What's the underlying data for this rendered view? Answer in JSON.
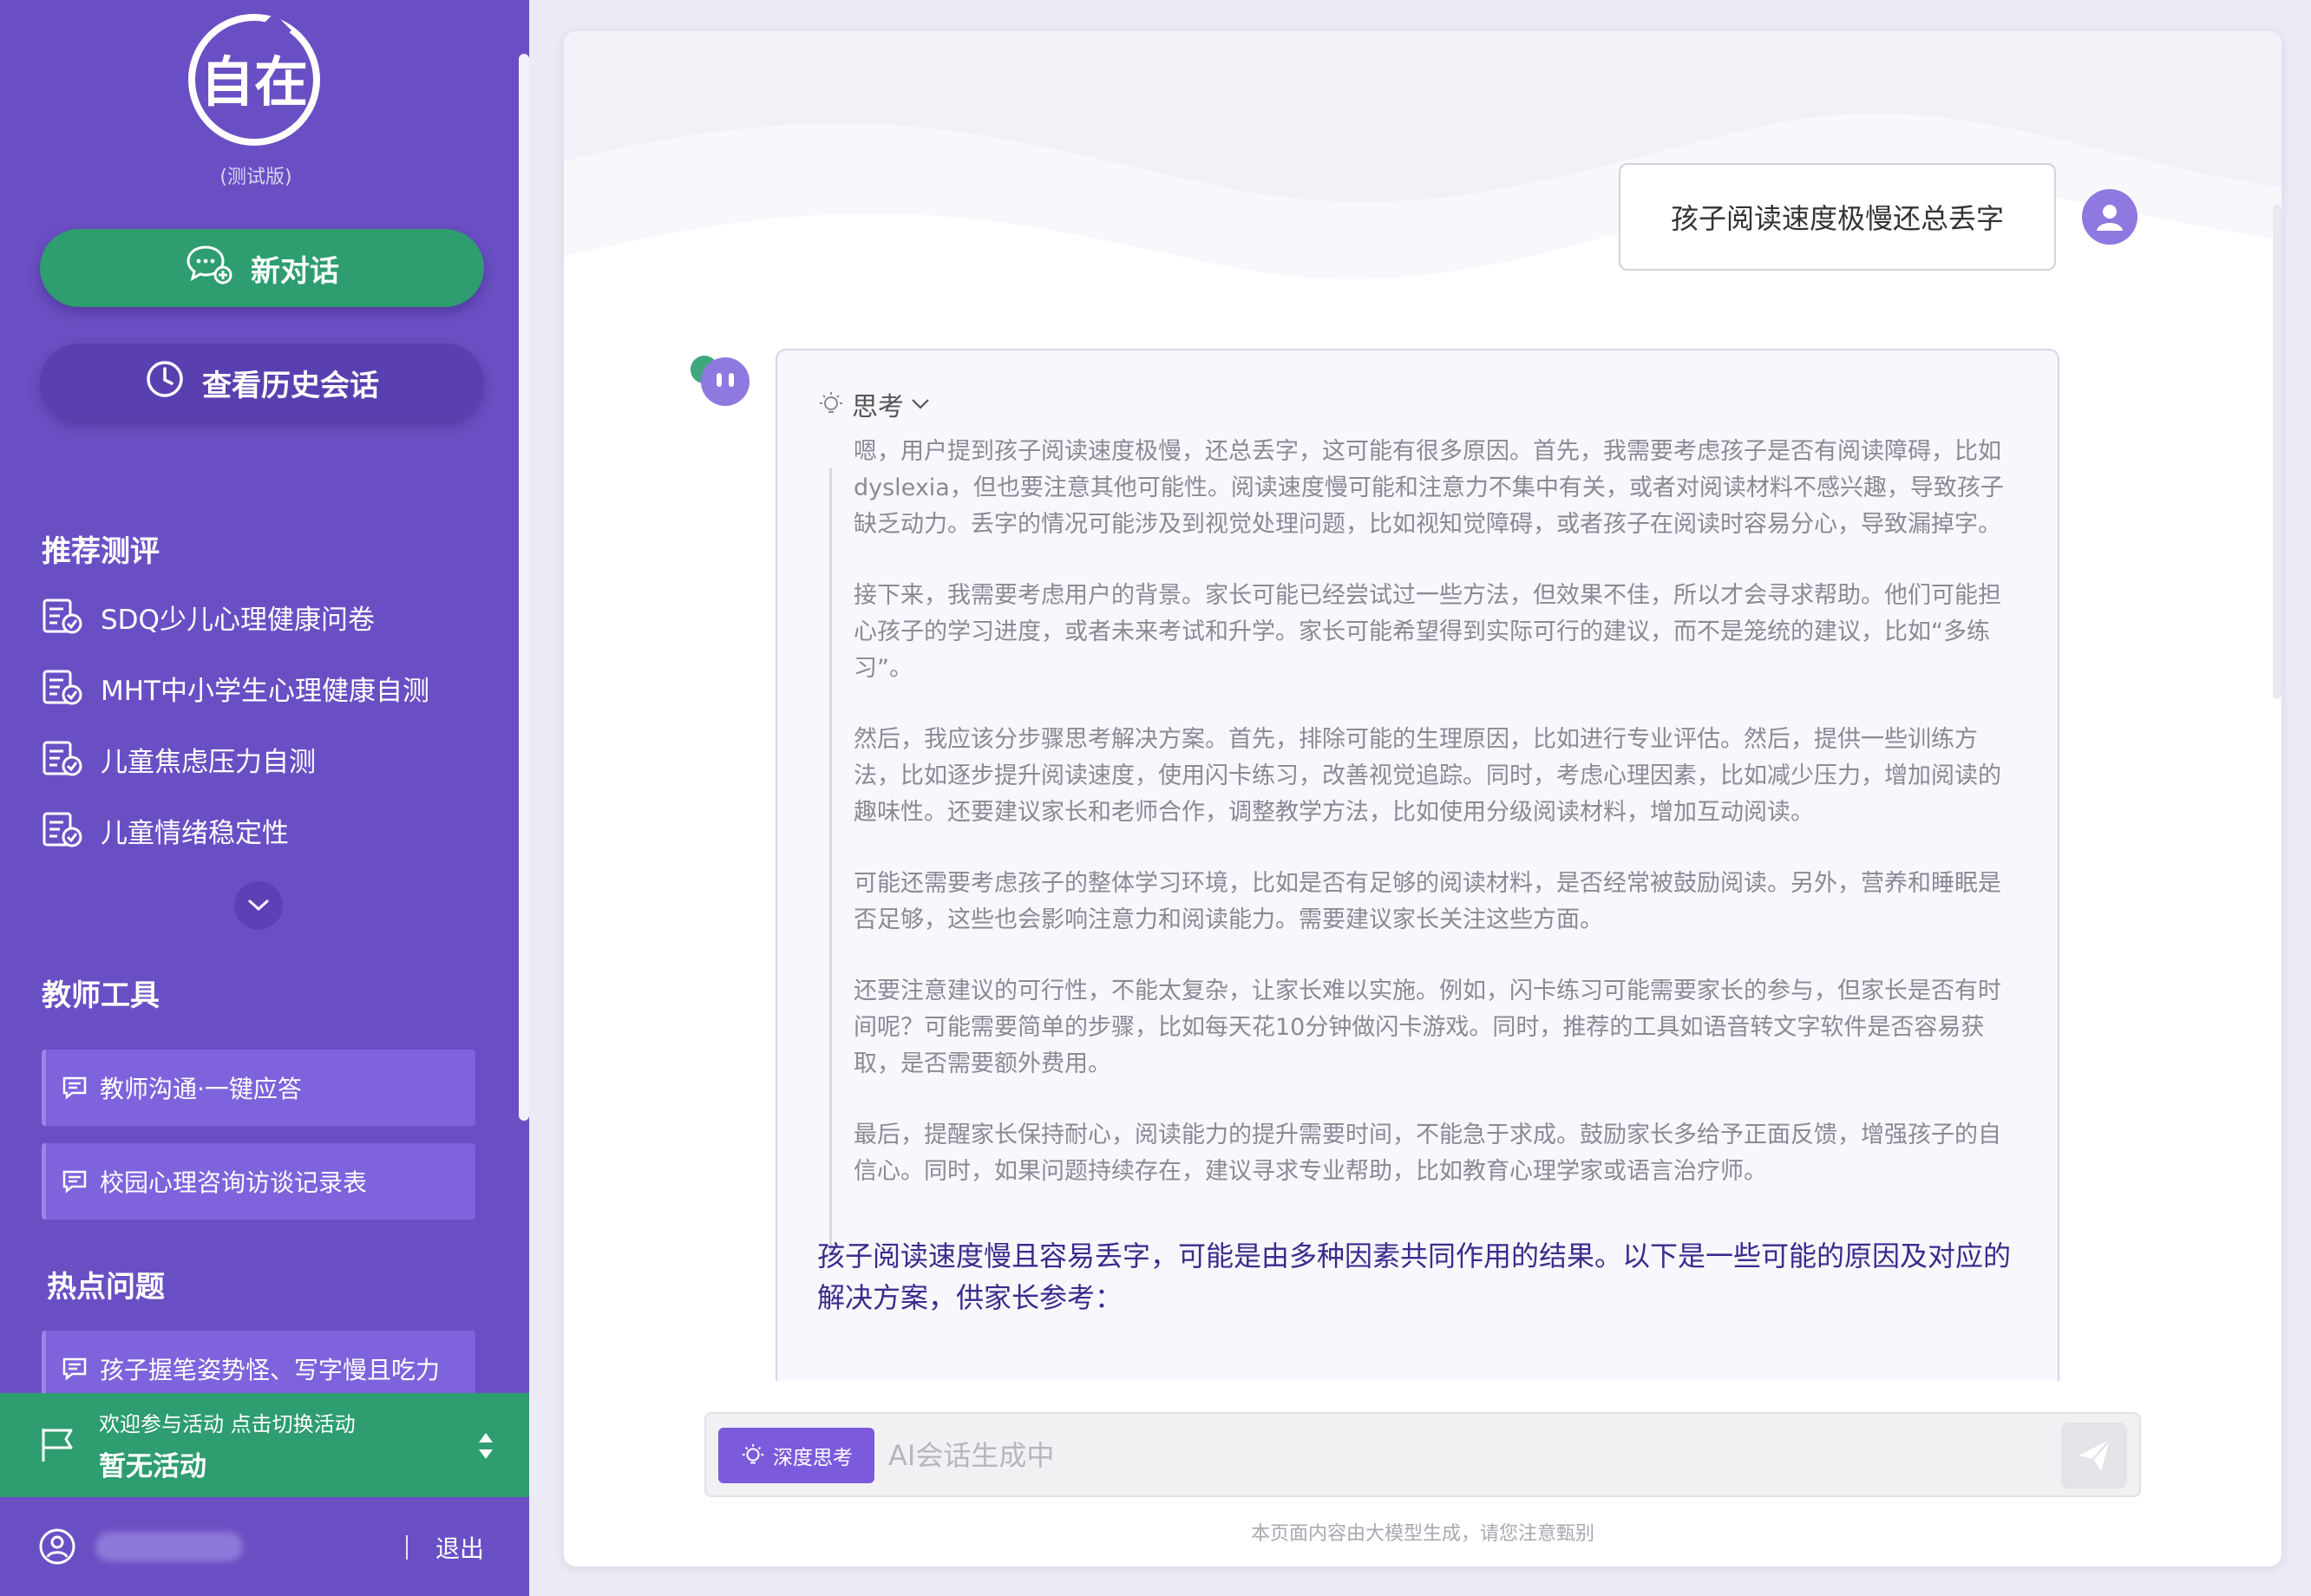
{
  "sidebar": {
    "logo_text": "自在",
    "logo_sub": "(测试版)",
    "new_chat_label": "新对话",
    "history_label": "查看历史会话",
    "assessments_title": "推荐测评",
    "assessments": [
      {
        "label": "SDQ少儿心理健康问卷",
        "icon": "clipboard-check-icon"
      },
      {
        "label": "MHT中小学生心理健康自测",
        "icon": "clipboard-check-icon"
      },
      {
        "label": "儿童焦虑压力自测",
        "icon": "clipboard-check-icon"
      },
      {
        "label": "儿童情绪稳定性",
        "icon": "clipboard-check-icon"
      }
    ],
    "tools_title": "教师工具",
    "tools": [
      {
        "label": "教师沟通·一键应答",
        "icon": "message-icon"
      },
      {
        "label": "校园心理咨询访谈记录表",
        "icon": "message-icon"
      }
    ],
    "hot_title": "热点问题",
    "hot_items": [
      {
        "label": "孩子握笔姿势怪、写字慢且吃力",
        "icon": "message-icon"
      }
    ],
    "activity": {
      "line1": "欢迎参与活动 点击切换活动",
      "line2": "暂无活动"
    },
    "logout_label": "退出"
  },
  "chat": {
    "user_message": "孩子阅读速度极慢还总丢字",
    "thinking_label": "思考",
    "thinking_paragraphs": [
      "嗯，用户提到孩子阅读速度极慢，还总丢字，这可能有很多原因。首先，我需要考虑孩子是否有阅读障碍，比如 dyslexia，但也要注意其他可能性。阅读速度慢可能和注意力不集中有关，或者对阅读材料不感兴趣，导致孩子缺乏动力。丢字的情况可能涉及到视觉处理问题，比如视知觉障碍，或者孩子在阅读时容易分心，导致漏掉字。",
      "接下来，我需要考虑用户的背景。家长可能已经尝试过一些方法，但效果不佳，所以才会寻求帮助。他们可能担心孩子的学习进度，或者未来考试和升学。家长可能希望得到实际可行的建议，而不是笼统的建议，比如“多练习”。",
      "然后，我应该分步骤思考解决方案。首先，排除可能的生理原因，比如进行专业评估。然后，提供一些训练方法，比如逐步提升阅读速度，使用闪卡练习，改善视觉追踪。同时，考虑心理因素，比如减少压力，增加阅读的趣味性。还要建议家长和老师合作，调整教学方法，比如使用分级阅读材料，增加互动阅读。",
      "可能还需要考虑孩子的整体学习环境，比如是否有足够的阅读材料，是否经常被鼓励阅读。另外，营养和睡眠是否足够，这些也会影响注意力和阅读能力。需要建议家长关注这些方面。",
      "还要注意建议的可行性，不能太复杂，让家长难以实施。例如，闪卡练习可能需要家长的参与，但家长是否有时间呢？可能需要简单的步骤，比如每天花10分钟做闪卡游戏。同时，推荐的工具如语音转文字软件是否容易获取，是否需要额外费用。",
      "最后，提醒家长保持耐心，阅读能力的提升需要时间，不能急于求成。鼓励家长多给予正面反馈，增强孩子的自信心。同时，如果问题持续存在，建议寻求专业帮助，比如教育心理学家或语言治疗师。"
    ],
    "answer_intro": "孩子阅读速度慢且容易丢字，可能是由多种因素共同作用的结果。以下是一些可能的原因及对应的解决方案，供家长参考："
  },
  "input": {
    "deep_think_label": "深度思考",
    "placeholder": "AI会话生成中"
  },
  "disclaimer": "本页面内容由大模型生成，请您注意甄别",
  "colors": {
    "sidebar_bg": "#6a4fc4",
    "green": "#2e9d6f",
    "accent": "#7b5bdc",
    "answer_text": "#3d2a8c"
  }
}
